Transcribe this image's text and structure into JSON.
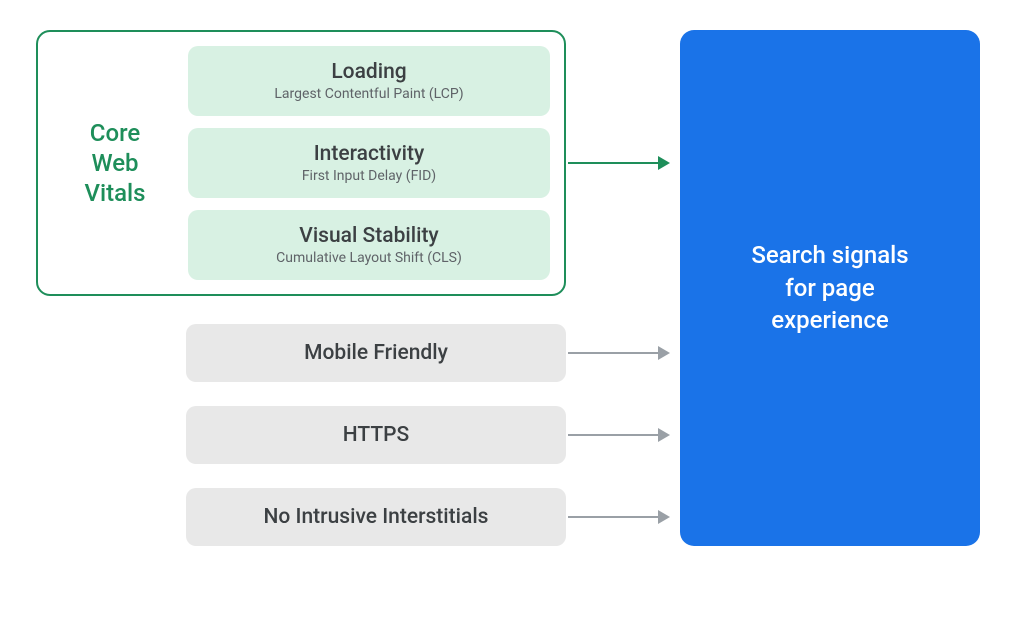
{
  "coreWebVitals": {
    "label_line1": "Core",
    "label_line2": "Web",
    "label_line3": "Vitals",
    "items": [
      {
        "title": "Loading",
        "sub": "Largest Contentful Paint (LCP)"
      },
      {
        "title": "Interactivity",
        "sub": "First Input Delay (FID)"
      },
      {
        "title": "Visual Stability",
        "sub": "Cumulative Layout Shift (CLS)"
      }
    ]
  },
  "otherSignals": [
    {
      "label": "Mobile Friendly"
    },
    {
      "label": "HTTPS"
    },
    {
      "label": "No Intrusive Interstitials"
    }
  ],
  "target": {
    "line1": "Search signals",
    "line2": "for page",
    "line3": "experience"
  },
  "colors": {
    "green": "#1e8e5a",
    "greenFill": "#d8f1e3",
    "grey": "#e8e8e8",
    "blue": "#1a73e8",
    "arrowGrey": "#9aa0a6"
  }
}
